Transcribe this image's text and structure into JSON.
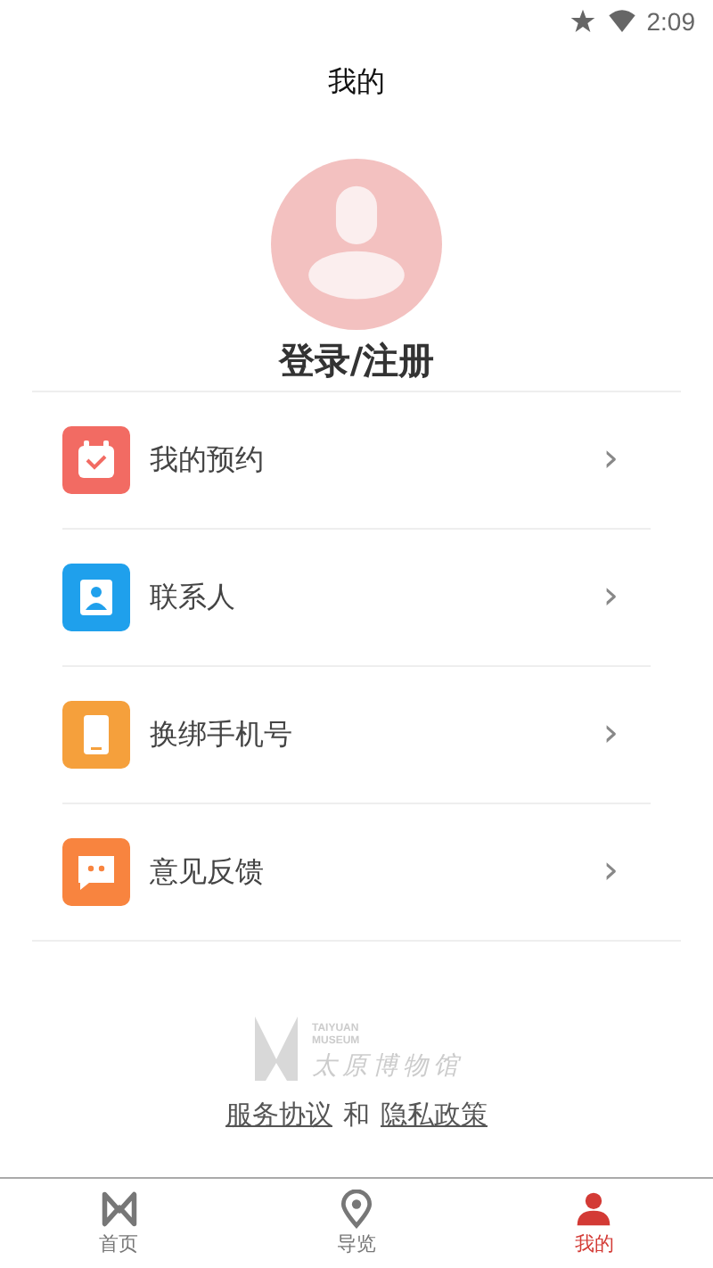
{
  "status_bar": {
    "time": "2:09"
  },
  "header": {
    "title": "我的"
  },
  "profile": {
    "login_label": "登录/注册"
  },
  "menu": [
    {
      "label": "我的预约",
      "kind": "calendar",
      "color": "#f26b63",
      "chevron": "›"
    },
    {
      "label": "联系人",
      "kind": "contact",
      "color": "#1fa0ec",
      "chevron": "›"
    },
    {
      "label": "换绑手机号",
      "kind": "phone",
      "color": "#f5a03c",
      "chevron": "›"
    },
    {
      "label": "意见反馈",
      "kind": "chat",
      "color": "#f8843f",
      "chevron": "›"
    }
  ],
  "logo": {
    "english_top": "TAIYUAN",
    "english_bottom": "MUSEUM",
    "chinese": "太原博物馆"
  },
  "agreement": {
    "terms_link": "服务协议",
    "joiner": "和",
    "privacy_link": "隐私政策"
  },
  "bottom_nav": [
    {
      "label": "首页",
      "kind": "home",
      "selected": false
    },
    {
      "label": "导览",
      "kind": "guide",
      "selected": false
    },
    {
      "label": "我的",
      "kind": "profile",
      "selected": true
    }
  ]
}
